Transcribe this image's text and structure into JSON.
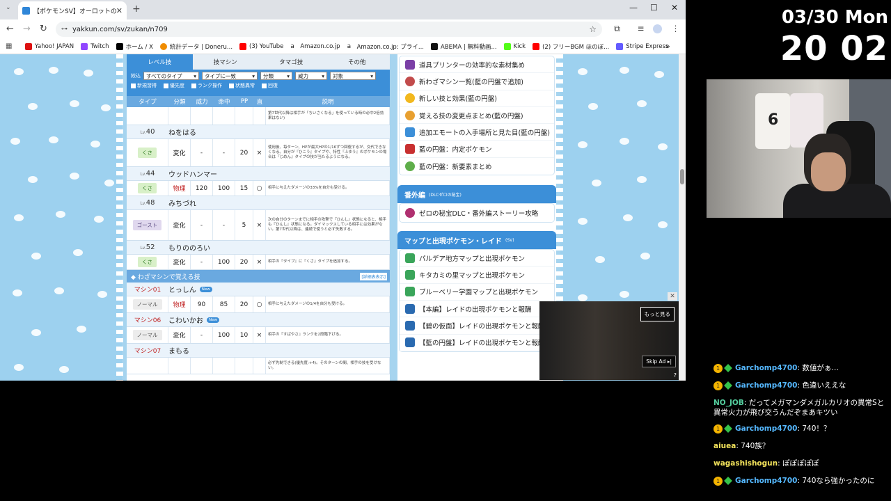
{
  "browser": {
    "tab_title": "【ポケモンSV】オーロットの覚える技・",
    "url": "yakkun.com/sv/zukan/n709",
    "bookmarks": [
      {
        "label": "Yahoo! JAPAN",
        "color": "#d11"
      },
      {
        "label": "Twitch",
        "color": "#9146ff"
      },
      {
        "label": "ホーム / X",
        "color": "#000"
      },
      {
        "label": "統計データ | Doneru...",
        "color": "#f08c00"
      },
      {
        "label": "(3) YouTube",
        "color": "#f00"
      },
      {
        "label": "Amazon.co.jp",
        "color": "#222"
      },
      {
        "label": "Amazon.co.jp: プライ...",
        "color": "#222"
      },
      {
        "label": "ABEMA | 無料動画...",
        "color": "#111"
      },
      {
        "label": "Kick",
        "color": "#53fc18"
      },
      {
        "label": "(2) フリーBGM ほのぼ...",
        "color": "#f00"
      },
      {
        "label": "Stripe Express",
        "color": "#635bff"
      }
    ],
    "more_label": "»"
  },
  "moves": {
    "tabs": [
      "レベル技",
      "技マシン",
      "タマゴ技",
      "その他"
    ],
    "filter_label": "絞込",
    "filters": [
      "すべてのタイプ",
      "タイプに一致",
      "分類",
      "威力",
      "対象"
    ],
    "checkboxes": [
      "新規習得",
      "優先度",
      "ランク操作",
      "状態異常",
      "回復"
    ],
    "headers": [
      "タイプ",
      "分類",
      "威力",
      "命中",
      "PP",
      "直",
      "説明"
    ],
    "top_desc": "第7世代以降は相手が「ちいさくなる」を使っている時の必中2倍効果はない)",
    "levels": [
      {
        "lv": "40",
        "name": "ねをはる",
        "type": "くさ",
        "cat": "変化",
        "power": "-",
        "acc": "-",
        "pp": "20",
        "contact": "×",
        "desc": "使用後、毎ターン、HPが最大HPの1/16ずつ回復するが、交代できなくなる。自分が『ひこう』タイプや、特性『ふゆう』のポケモンの場合は『じめん』タイプの技が当たるようになる。"
      },
      {
        "lv": "44",
        "name": "ウッドハンマー",
        "type": "くさ",
        "cat": "物理",
        "power": "120",
        "acc": "100",
        "pp": "15",
        "contact": "○",
        "desc": "相手に与えたダメージの33%を自分も受ける。"
      },
      {
        "lv": "48",
        "name": "みちづれ",
        "type": "ゴースト",
        "cat": "変化",
        "power": "-",
        "acc": "-",
        "pp": "5",
        "contact": "×",
        "desc": "次の自分のターンまでに相手の攻撃で『ひんし』状態になると、相手も『ひんし』状態になる。ダイマックスしている相手には効果がない。第7世代以降は、連続で使うと必ず失敗する。"
      },
      {
        "lv": "52",
        "name": "もりののろい",
        "type": "くさ",
        "cat": "変化",
        "power": "-",
        "acc": "100",
        "pp": "20",
        "contact": "×",
        "desc": "相手の『タイプ』に『くさ』タイプを追加する。"
      }
    ],
    "section_title": "わざマシンで覚える技",
    "section_more": "[詳細表表示]",
    "lv_prefix": "Lv.",
    "tm_prefix": "マシン",
    "new_label": "New",
    "tms": [
      {
        "no": "01",
        "name": "とっしん",
        "is_new": true,
        "type": "ノーマル",
        "cat": "物理",
        "power": "90",
        "acc": "85",
        "pp": "20",
        "contact": "○",
        "desc": "相手に与えたダメージの1/4を自分も受ける。"
      },
      {
        "no": "06",
        "name": "こわいかお",
        "is_new": true,
        "type": "ノーマル",
        "cat": "変化",
        "power": "-",
        "acc": "100",
        "pp": "10",
        "contact": "×",
        "desc": "相手の『すばやさ』ランクを2段階下げる。"
      },
      {
        "no": "07",
        "name": "まもる",
        "is_new": false
      }
    ],
    "bottom_desc": "必ず先制できる(優先度:+4)。そのターンの間、相手の技を受けない。"
  },
  "sidebar": {
    "top_items": [
      "道具プリンターの効率的な素材集め",
      "新わざマシン一覧(藍の円盤で追加)",
      "新しい技と効果(藍の円盤)",
      "覚える技の変更点まとめ(藍の円盤)",
      "追加エモートの入手場所と見た目(藍の円盤)",
      "藍の円盤：内定ポケモン",
      "藍の円盤：新要素まとめ"
    ],
    "extra_title": "番外編",
    "extra_sub": "(DLCゼロの秘宝)",
    "extra_items": [
      "ゼロの秘宝DLC・番外編ストーリー攻略"
    ],
    "map_title": "マップと出現ポケモン・レイド",
    "map_sub": "(SV)",
    "map_items": [
      "パルデア地方マップと出現ポケモン",
      "キタカミの里マップと出現ポケモン",
      "ブルーベリー学園マップと出現ポケモン",
      "【本編】レイドの出現ポケモンと報酬",
      "【碧の仮面】レイドの出現ポケモンと報酬",
      "【藍の円盤】レイドの出現ポケモンと報酬"
    ]
  },
  "ad": {
    "more": "もっと見る",
    "skip": "Skip Ad ▸|",
    "info": "?"
  },
  "clock": {
    "date": "03/30 Mon",
    "time": "20 02"
  },
  "chat": [
    {
      "user": "Garchomp4700",
      "text": ": 数値がぁ…",
      "badges": true,
      "color": "blue"
    },
    {
      "user": "Garchomp4700",
      "text": ": 色違いええな",
      "badges": true,
      "color": "blue"
    },
    {
      "user": "NO_JOB",
      "text": ": だってメガマンダメガルカリオの異常Sと異常火力が飛び交うんだぞまあキツい",
      "badges": false,
      "color": "green"
    },
    {
      "user": "Garchomp4700",
      "text": ": 740！？",
      "badges": true,
      "color": "blue"
    },
    {
      "user": "aiuea",
      "text": ": 740族？",
      "badges": false,
      "color": "yellow"
    },
    {
      "user": "wagashishogun",
      "text": ": ぽぽぽぽぽ",
      "badges": false,
      "color": "yellow"
    },
    {
      "user": "Garchomp4700",
      "text": ": 740なら強かったのに",
      "badges": true,
      "color": "blue"
    }
  ]
}
